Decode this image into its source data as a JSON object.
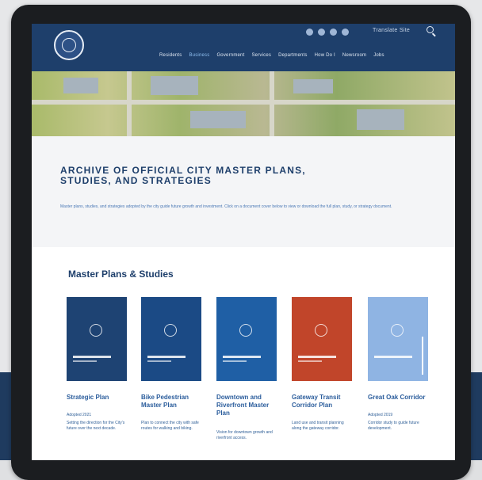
{
  "colors": {
    "header_bg": "#1e3f6b",
    "title": "#1e3f6b",
    "link": "#2b5d9c",
    "cover_dark": "#1e4373",
    "cover_medium": "#1f5fa5",
    "cover_red": "#c1452a",
    "cover_light": "#8fb4e3"
  },
  "header": {
    "logo": "city-seal-icon",
    "social_icons": [
      "facebook-icon",
      "twitter-icon",
      "instagram-icon",
      "youtube-icon"
    ],
    "lang_link": "Translate Site",
    "search_icon": "search-icon",
    "nav": [
      "Residents",
      "Business",
      "Government",
      "Services",
      "Departments",
      "How Do I",
      "Newsroom",
      "Jobs"
    ]
  },
  "intro": {
    "title": "ARCHIVE OF OFFICIAL CITY MASTER PLANS, STUDIES, AND STRATEGIES",
    "text": "Master plans, studies, and strategies adopted by the city guide future growth and investment. Click on a document cover below to view or download the full plan, study, or strategy document."
  },
  "section": {
    "heading": "Master Plans & Studies",
    "cards": [
      {
        "title": "Strategic Plan",
        "meta": "Adopted 2021",
        "desc": "Setting the direction for the City's future over the next decade."
      },
      {
        "title": "Bike Pedestrian Master Plan",
        "meta": "",
        "desc": "Plan to connect the city with safe routes for walking and biking."
      },
      {
        "title": "Downtown and Riverfront Master Plan",
        "meta": "",
        "desc": "Vision for downtown growth and riverfront access."
      },
      {
        "title": "Gateway Transit Corridor Plan",
        "meta": "",
        "desc": "Land use and transit planning along the gateway corridor."
      },
      {
        "title": "Great Oak Corridor",
        "meta": "Adopted 2019",
        "desc": "Corridor study to guide future development."
      }
    ]
  }
}
